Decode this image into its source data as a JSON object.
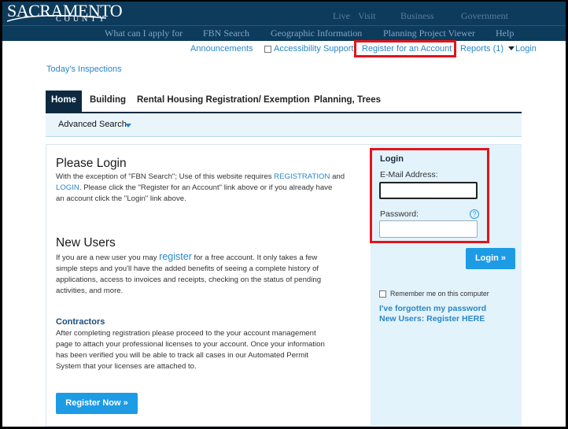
{
  "header": {
    "logo_main": "SACRAMENTO",
    "logo_sub": "COUNTY",
    "top_links": [
      "Live",
      "Visit",
      "Business",
      "Government"
    ],
    "nav": [
      "What can I apply for",
      "FBN Search",
      "Geographic Information",
      "Planning Project Viewer",
      "Help"
    ]
  },
  "utility": {
    "announcements": "Announcements",
    "accessibility": "Accessibility Support",
    "register": "Register for an Account",
    "reports": "Reports (1)",
    "login": "Login"
  },
  "today_inspections": "Today's Inspections",
  "tabs": [
    "Home",
    "Building",
    "Rental Housing Registration/ Exemption",
    "Planning, Trees"
  ],
  "subnav": {
    "advanced_search": "Advanced Search"
  },
  "content": {
    "please_login_title": "Please Login",
    "please_login_1": "With the exception of \"FBN Search\"; Use of this website requires ",
    "please_login_link1": "REGISTRATION",
    "please_login_and": " and",
    "please_login_link2": "LOGIN",
    "please_login_2": ". Please click the \"Register for an Account\" link above or if you already have",
    "please_login_3": "an account click the \"Login\" link above.",
    "new_users_title": "New Users",
    "new_users_1a": "If you are a new user you may ",
    "new_users_link": "register",
    "new_users_1b": " for a free account. It only takes a few",
    "new_users_2": "simple steps and you'll have the added benefits of seeing a complete history of",
    "new_users_3": "applications, access to invoices and receipts, checking on the status of pending",
    "new_users_4": "activities, and more.",
    "contractors_title": "Contractors",
    "contractors_1": "After completing registration please proceed to the your account management",
    "contractors_2": "page to attach your professional licenses to your account. Once your information",
    "contractors_3": "has been verified you will be able to track all cases in our Automated Permit",
    "contractors_4": "System that your licenses are attached to.",
    "register_now": "Register Now »"
  },
  "login_panel": {
    "title": "Login",
    "email_label": "E-Mail Address:",
    "email_value": "",
    "password_label": "Password:",
    "password_value": "",
    "help_icon_text": "?",
    "login_button": "Login »",
    "remember": "Remember me on this computer",
    "forgot": "I've forgotten my password",
    "register_here": "New Users: Register HERE"
  },
  "colors": {
    "header_bg": "#0d3b5c",
    "link": "#2a86c6",
    "button": "#1d9be5",
    "highlight": "#e2141b",
    "panel_bg": "#e3f3fb"
  }
}
